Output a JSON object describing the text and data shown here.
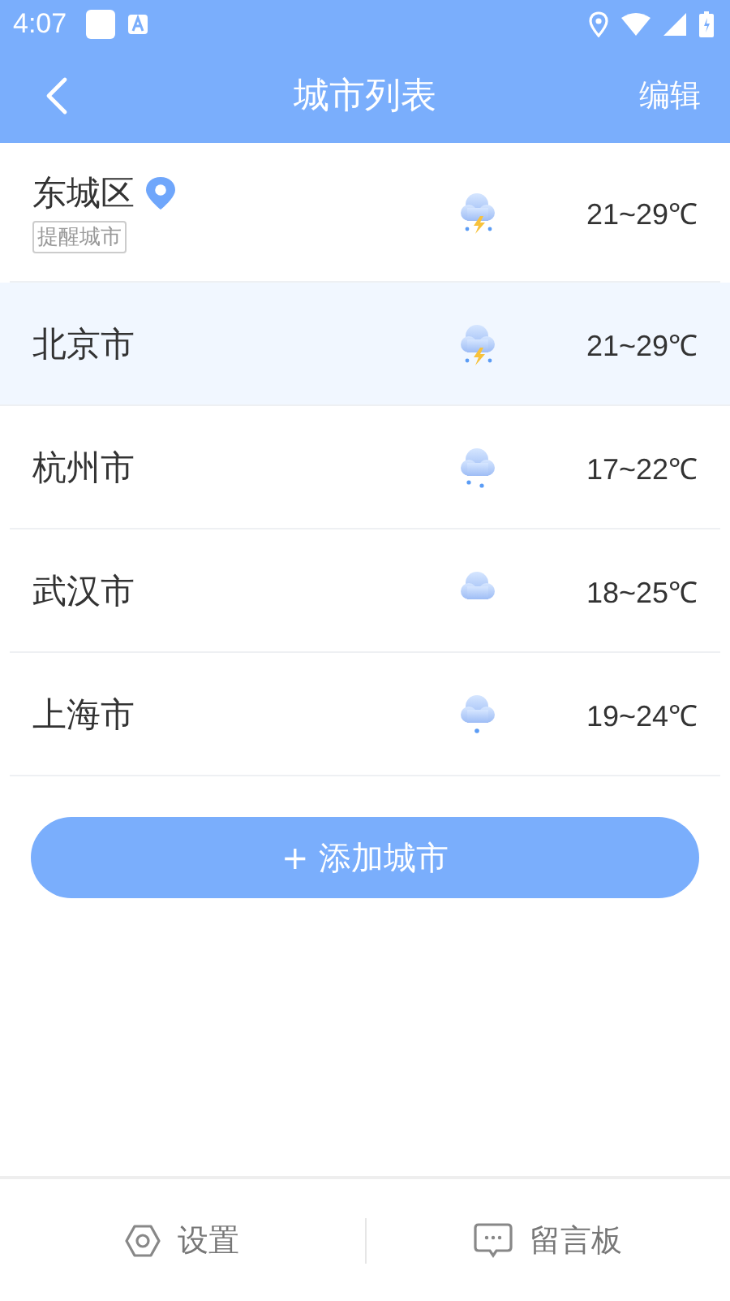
{
  "status_bar": {
    "time": "4:07"
  },
  "header": {
    "title": "城市列表",
    "action": "编辑"
  },
  "cities": [
    {
      "name": "东城区",
      "located": true,
      "tag": "提醒城市",
      "kind": "thunderstorm",
      "temp": "21~29℃",
      "selected": false
    },
    {
      "name": "北京市",
      "located": false,
      "kind": "thunderstorm",
      "temp": "21~29℃",
      "selected": true
    },
    {
      "name": "杭州市",
      "located": false,
      "kind": "rain",
      "temp": "17~22℃",
      "selected": false
    },
    {
      "name": "武汉市",
      "located": false,
      "kind": "cloudy",
      "temp": "18~25℃",
      "selected": false
    },
    {
      "name": "上海市",
      "located": false,
      "kind": "drizzle",
      "temp": "19~24℃",
      "selected": false
    }
  ],
  "add_button": "+ 添加城市",
  "bottom_bar": [
    {
      "kind": "settings",
      "label": "设置"
    },
    {
      "kind": "message",
      "label": "留言板"
    }
  ]
}
